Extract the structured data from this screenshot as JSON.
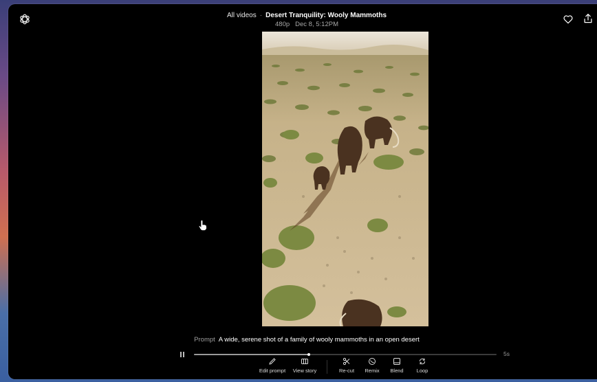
{
  "header": {
    "breadcrumb_root": "All videos",
    "separator": "·",
    "video_title": "Desert Tranquility: Wooly Mammoths",
    "resolution": "480p",
    "timestamp": "Dec 8, 5:12PM"
  },
  "icons": {
    "logo": "openai-logo",
    "favorite": "heart-icon",
    "share": "upload-icon",
    "cursor": "hand-pointer-cursor"
  },
  "prompt": {
    "label": "Prompt",
    "text": "A wide, serene shot of a family of wooly mammoths in an open desert"
  },
  "player": {
    "duration": "5s",
    "progress": 0.38
  },
  "toolbar": {
    "edit_prompt": "Edit prompt",
    "view_story": "View story",
    "recut": "Re-cut",
    "remix": "Remix",
    "blend": "Blend",
    "loop": "Loop"
  },
  "colors": {
    "window_bg": "#000000",
    "text_primary": "#ffffff",
    "text_secondary": "#a8a8a8"
  }
}
